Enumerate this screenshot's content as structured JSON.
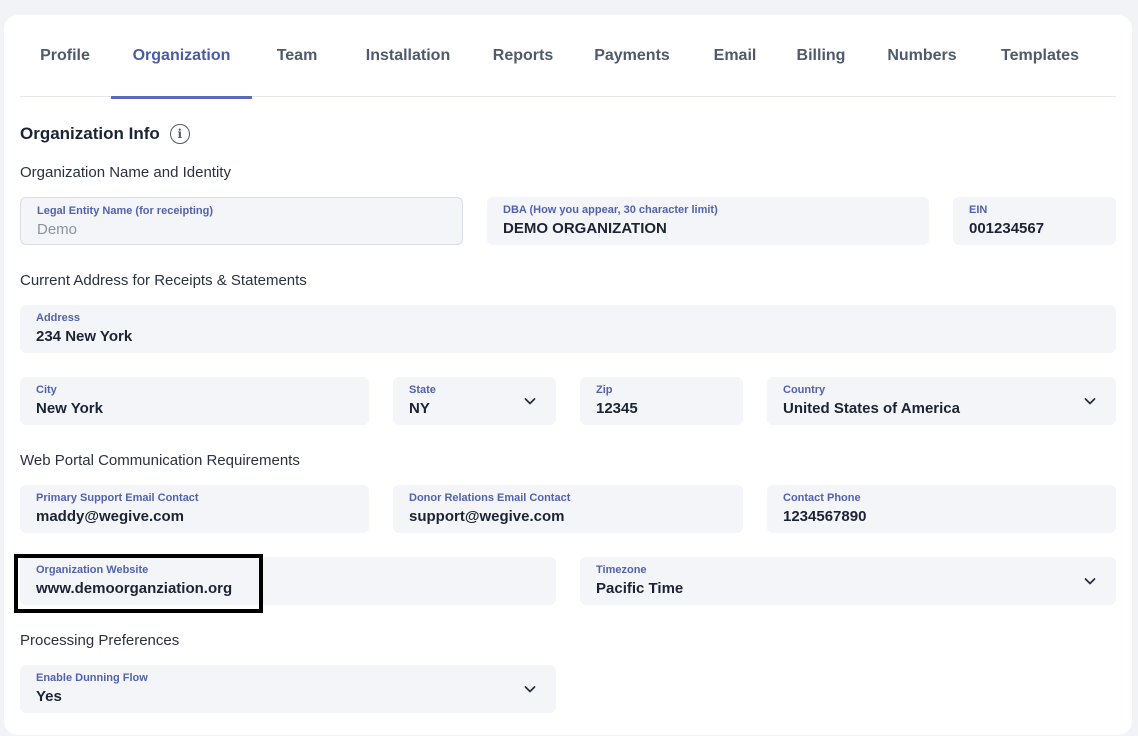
{
  "tabs": [
    {
      "label": "Profile"
    },
    {
      "label": "Organization"
    },
    {
      "label": "Team"
    },
    {
      "label": "Installation"
    },
    {
      "label": "Reports"
    },
    {
      "label": "Payments"
    },
    {
      "label": "Email"
    },
    {
      "label": "Billing"
    },
    {
      "label": "Numbers"
    },
    {
      "label": "Templates"
    }
  ],
  "active_tab": "Organization",
  "section": {
    "title": "Organization Info",
    "info_icon": "info-icon"
  },
  "groups": {
    "identity": "Organization Name and Identity",
    "address": "Current Address for Receipts & Statements",
    "portal": "Web Portal Communication Requirements",
    "processing": "Processing Preferences"
  },
  "fields": {
    "legal_name": {
      "label": "Legal Entity Name (for receipting)",
      "value": "Demo"
    },
    "dba": {
      "label": "DBA (How you appear, 30 character limit)",
      "value": "DEMO ORGANIZATION"
    },
    "ein": {
      "label": "EIN",
      "value": "001234567"
    },
    "address": {
      "label": "Address",
      "value": "234 New York"
    },
    "city": {
      "label": "City",
      "value": "New York"
    },
    "state": {
      "label": "State",
      "value": "NY"
    },
    "zip": {
      "label": "Zip",
      "value": "12345"
    },
    "country": {
      "label": "Country",
      "value": "United States of America"
    },
    "support_email": {
      "label": "Primary Support Email Contact",
      "value": "maddy@wegive.com"
    },
    "donor_email": {
      "label": "Donor Relations Email Contact",
      "value": "support@wegive.com"
    },
    "phone": {
      "label": "Contact Phone",
      "value": "1234567890"
    },
    "website": {
      "label": "Organization Website",
      "value": "www.demoorganziation.org"
    },
    "timezone": {
      "label": "Timezone",
      "value": "Pacific Time"
    },
    "dunning": {
      "label": "Enable Dunning Flow",
      "value": "Yes"
    }
  },
  "colors": {
    "accent": "#5b6ab8",
    "field_bg": "#f3f5f9",
    "label": "#5362ad"
  }
}
